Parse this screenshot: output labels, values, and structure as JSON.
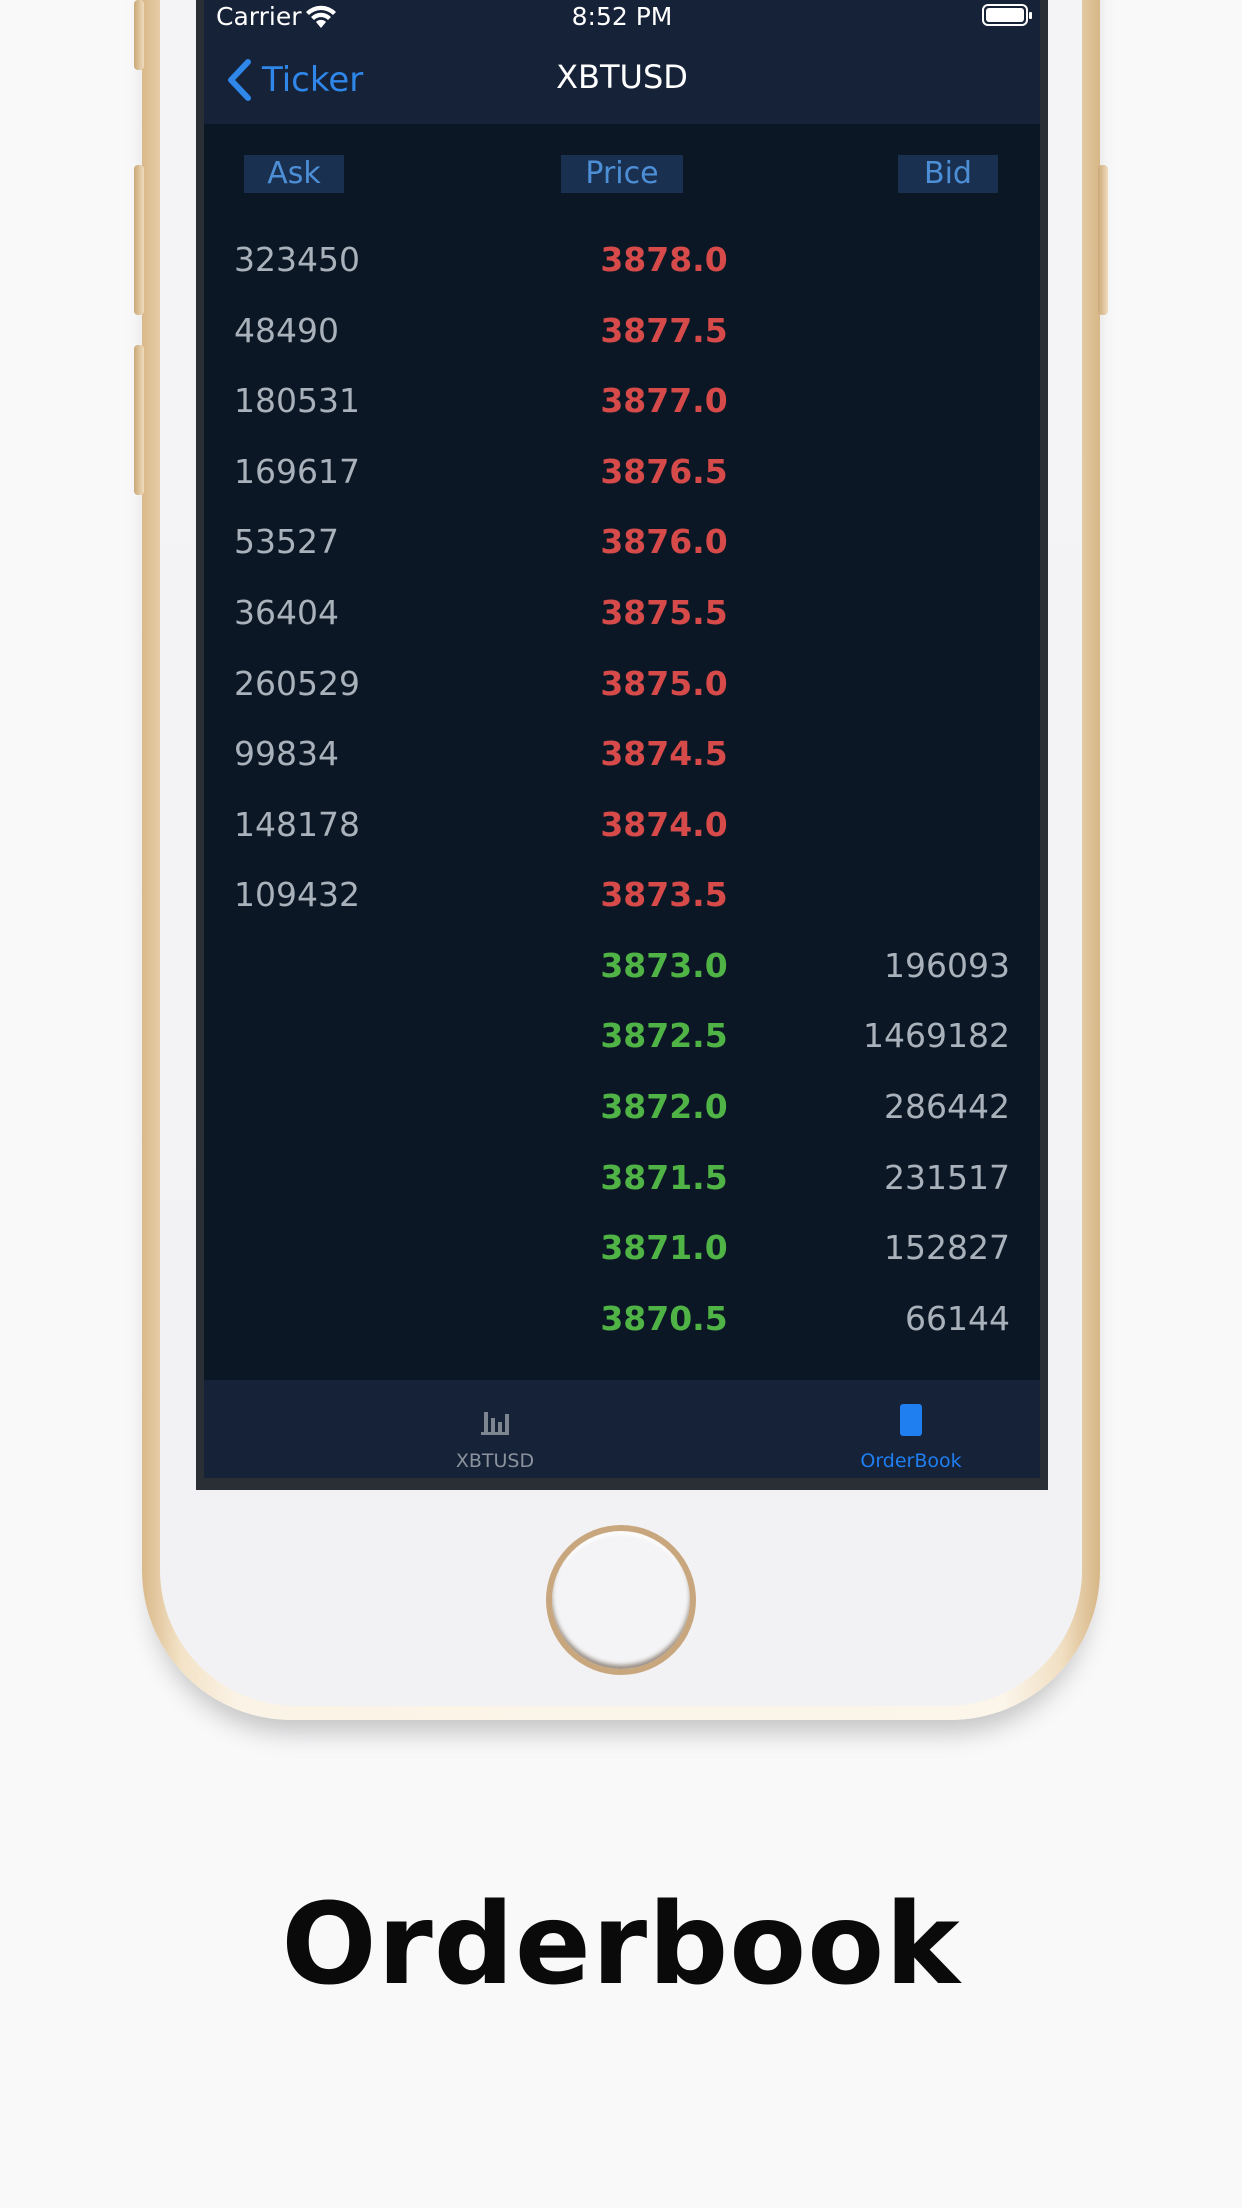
{
  "status_bar": {
    "carrier": "Carrier",
    "time": "8:52 PM"
  },
  "nav": {
    "back_label": "Ticker",
    "title": "XBTUSD"
  },
  "columns": {
    "ask": "Ask",
    "price": "Price",
    "bid": "Bid"
  },
  "asks": [
    {
      "ask": "323450",
      "price": "3878.0"
    },
    {
      "ask": "48490",
      "price": "3877.5"
    },
    {
      "ask": "180531",
      "price": "3877.0"
    },
    {
      "ask": "169617",
      "price": "3876.5"
    },
    {
      "ask": "53527",
      "price": "3876.0"
    },
    {
      "ask": "36404",
      "price": "3875.5"
    },
    {
      "ask": "260529",
      "price": "3875.0"
    },
    {
      "ask": "99834",
      "price": "3874.5"
    },
    {
      "ask": "148178",
      "price": "3874.0"
    },
    {
      "ask": "109432",
      "price": "3873.5"
    }
  ],
  "bids": [
    {
      "price": "3873.0",
      "bid": "196093"
    },
    {
      "price": "3872.5",
      "bid": "1469182"
    },
    {
      "price": "3872.0",
      "bid": "286442"
    },
    {
      "price": "3871.5",
      "bid": "231517"
    },
    {
      "price": "3871.0",
      "bid": "152827"
    },
    {
      "price": "3870.5",
      "bid": "66144"
    }
  ],
  "tabs": [
    {
      "label": "XBTUSD",
      "icon": "bar-chart-icon",
      "active": false
    },
    {
      "label": "OrderBook",
      "icon": "book-icon",
      "active": true
    }
  ],
  "caption": "Orderbook",
  "colors": {
    "ask_price": "#d64a4a",
    "bid_price": "#4fb346",
    "accent": "#2f87ea",
    "background": "#0b1724"
  }
}
